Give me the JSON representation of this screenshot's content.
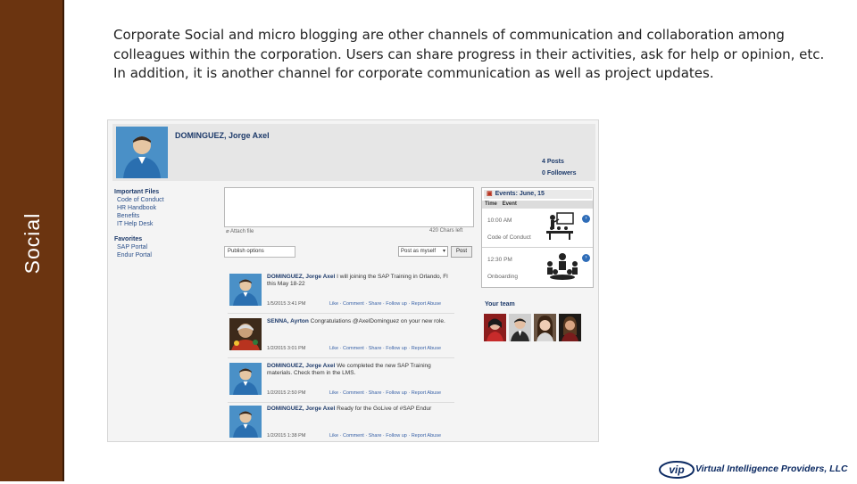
{
  "sidebar": {
    "title": "Social"
  },
  "intro": {
    "lines": [
      "Corporate Social and micro blogging are other channels of communication and collaboration among",
      "colleagues within the corporation.  Users can share progress in their activities, ask for help or opinion, etc.",
      "In addition, it is another channel for corporate communication as well as project updates."
    ]
  },
  "profile": {
    "name": "DOMINGUEZ, Jorge Axel",
    "posts": "4 Posts",
    "followers": "0 Followers"
  },
  "left_panel": {
    "important_files_label": "Important Files",
    "files": [
      "Code of Conduct",
      "HR Handbook",
      "Benefits",
      "IT Help Desk"
    ],
    "favorites_label": "Favorites",
    "favorites": [
      "SAP Portal",
      "Endur Portal"
    ]
  },
  "composer": {
    "attach_label": "Attach file",
    "chars_left": "420 Chars left",
    "publish_placeholder": "Publish options",
    "post_as": "Post as myself",
    "post_button": "Post"
  },
  "feed": [
    {
      "author": "DOMINGUEZ, Jorge Axel",
      "text": "I will joining the SAP Training in Orlando, Fl this May 18-22",
      "time": "1/5/2015 3:41 PM",
      "actions": "Like · Comment · Share · Follow up · Report Abuse"
    },
    {
      "author": "SENNA, Ayrton",
      "text": "Congratulations @AxelDominguez on your new role.",
      "time": "1/2/2015 3:01 PM",
      "actions": "Like · Comment · Share · Follow up · Report Abuse"
    },
    {
      "author": "DOMINGUEZ, Jorge Axel",
      "text": "We completed the new SAP Training materials. Check them in the LMS.",
      "time": "1/2/2015 2:50 PM",
      "actions": "Like · Comment · Share · Follow up · Report Abuse"
    },
    {
      "author": "DOMINGUEZ, Jorge Axel",
      "text": "Ready for the GoLive of #SAP Endur",
      "time": "1/2/2015 1:38 PM",
      "actions": "Like · Comment · Share · Follow up · Report Abuse"
    }
  ],
  "events": {
    "title": "Events: June, 15",
    "col_time": "Time",
    "col_event": "Event",
    "items": [
      {
        "time": "10:00 AM",
        "name": "Code of Conduct",
        "icon": "presentation-icon"
      },
      {
        "time": "12:30 PM",
        "name": "Onboarding",
        "icon": "meeting-icon"
      }
    ]
  },
  "team": {
    "title": "Your team"
  },
  "brand": {
    "logo_text": "vip",
    "name": "Virtual Intelligence Providers, LLC",
    "color": "#0d2b63"
  },
  "colors": {
    "sidebar": "#6b3410",
    "accent_blue": "#1d3a6a",
    "avatar_blue": "#4a90c7"
  }
}
